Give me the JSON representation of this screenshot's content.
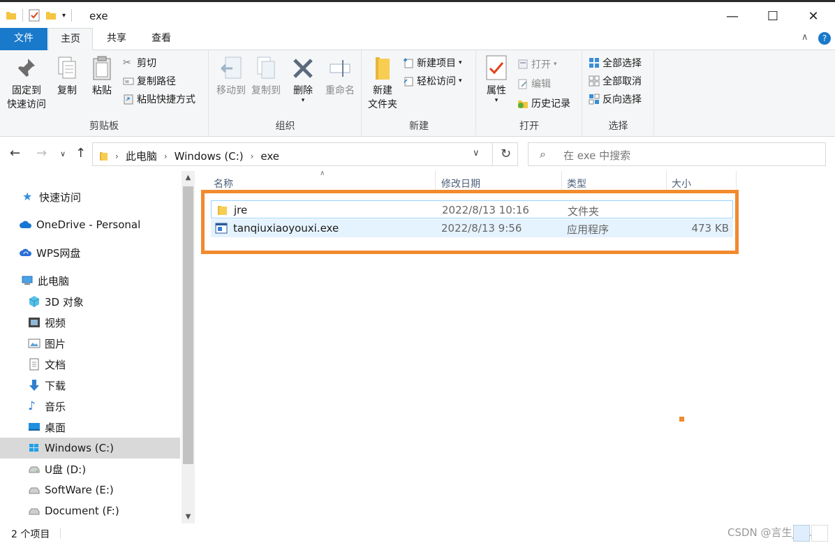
{
  "window": {
    "title": "exe",
    "minimize": "—",
    "maximize": "☐",
    "close": "✕"
  },
  "tabs": [
    "文件",
    "主页",
    "共享",
    "查看"
  ],
  "ribbon": {
    "clipboard": {
      "label": "剪贴板",
      "pin_line1": "固定到",
      "pin_line2": "快速访问",
      "copy": "复制",
      "paste": "粘贴",
      "cut": "剪切",
      "copy_path": "复制路径",
      "paste_shortcut": "粘贴快捷方式"
    },
    "organize": {
      "label": "组织",
      "move_to": "移动到",
      "copy_to": "复制到",
      "delete": "删除",
      "rename": "重命名"
    },
    "new": {
      "label": "新建",
      "new_folder_line1": "新建",
      "new_folder_line2": "文件夹",
      "new_item": "新建项目",
      "easy_access": "轻松访问"
    },
    "open": {
      "label": "打开",
      "properties": "属性",
      "open": "打开",
      "edit": "编辑",
      "history": "历史记录"
    },
    "select": {
      "label": "选择",
      "select_all": "全部选择",
      "select_none": "全部取消",
      "invert": "反向选择"
    }
  },
  "address": {
    "crumbs": [
      "此电脑",
      "Windows (C:)",
      "exe"
    ]
  },
  "search": {
    "placeholder": "在 exe 中搜索"
  },
  "nav_pane": {
    "items": [
      {
        "label": "快速访问"
      },
      {
        "label": "OneDrive - Personal"
      },
      {
        "label": "WPS网盘"
      },
      {
        "label": "此电脑"
      },
      {
        "label": "3D 对象"
      },
      {
        "label": "视频"
      },
      {
        "label": "图片"
      },
      {
        "label": "文档"
      },
      {
        "label": "下载"
      },
      {
        "label": "音乐"
      },
      {
        "label": "桌面"
      },
      {
        "label": "Windows (C:)"
      },
      {
        "label": "U盘 (D:)"
      },
      {
        "label": "SoftWare (E:)"
      },
      {
        "label": "Document (F:)"
      }
    ]
  },
  "columns": {
    "name": "名称",
    "date": "修改日期",
    "type": "类型",
    "size": "大小"
  },
  "files": [
    {
      "name": "jre",
      "date": "2022/8/13 10:16",
      "type": "文件夹",
      "size": ""
    },
    {
      "name": "tanqiuxiaoyouxi.exe",
      "date": "2022/8/13 9:56",
      "type": "应用程序",
      "size": "473 KB"
    }
  ],
  "status": {
    "count": "2 个项目",
    "watermark": "CSDN @言生_blue"
  },
  "colors": {
    "accent": "#1979ca",
    "highlight_box": "#f28a2e",
    "selection": "#e5f3ff"
  }
}
